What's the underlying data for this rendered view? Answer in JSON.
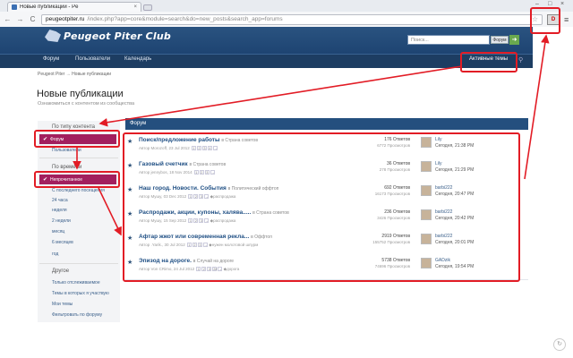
{
  "browser": {
    "tab_title": "Новые публикации - Pe",
    "tab_close": "×",
    "url_host": "peugeotpiter.ru",
    "url_path": "/index.php?app=core&module=search&do=new_posts&search_app=forums",
    "back": "←",
    "forward": "→",
    "reload": "C",
    "star": "☆",
    "ext_label": "D",
    "menu": "≡",
    "win_min": "–",
    "win_max": "□",
    "win_close": "×"
  },
  "site": {
    "logo_text": "Peugeot Piter Club",
    "search_placeholder": "Поиск...",
    "search_scope": "Форум",
    "search_go": "➜",
    "nav": [
      "Форум",
      "Пользователи",
      "Календарь"
    ],
    "active_topics": "Активные темы",
    "pin": "⚲"
  },
  "breadcrumb": "Peugeot Piter  →  Новые публикации",
  "page": {
    "title": "Новые публикации",
    "subtitle": "Ознакомиться с контентом из сообщества"
  },
  "sidebar": {
    "head_content": "По типу контента",
    "active_forum": "Форум",
    "users": "Пользователи",
    "head_time": "По времени",
    "active_unread": "Непрочитанное",
    "time_items": [
      "С последнего посещения",
      "24 часа",
      "неделя",
      "2 недели",
      "месяц",
      "6 месяцев",
      "год"
    ],
    "head_other": "Другое",
    "other_items": [
      "Только отслеживаемое",
      "Темы в которых я участвую",
      "Мои темы",
      "Фильтровать по форуму"
    ],
    "check": "✔"
  },
  "panel_title": "Форум",
  "topics": [
    {
      "title": "Поиск/предложение работы",
      "forum": "в Страна советов",
      "meta": "Автор Morozoff, 23 Jul 2012",
      "pages": [
        "1",
        "2",
        "3",
        "4"
      ],
      "replies": "176 Ответов",
      "views": "6772 Просмотров",
      "user": "Lily",
      "date": "Сегодня, 21:38 PM"
    },
    {
      "title": "Газовый счетчик",
      "forum": "в Страна советов",
      "meta": "Автор jennybos, 18 Nov 2014",
      "pages": [
        "1",
        "2",
        "3"
      ],
      "replies": "36 Ответов",
      "views": "278 Просмотров",
      "user": "Lily",
      "date": "Сегодня, 21:29 PM"
    },
    {
      "title": "Наш город. Новости. События",
      "forum": "в Политический оффтоп",
      "meta": "Автор Myшy, 03 Dec 2012",
      "pages": [
        "1",
        "2",
        "3"
      ],
      "tag": "распродажа",
      "replies": "692 Ответов",
      "views": "16173 Просмотров",
      "user": "barbi222",
      "date": "Сегодня, 20:47 PM"
    },
    {
      "title": "Распродажи, акции, купоны, халява.....",
      "forum": "в Страна советов",
      "meta": "Автор Myшy, 15 Sep 2012",
      "pages": [
        "1",
        "2",
        "3"
      ],
      "tag": "распродажа",
      "replies": "236 Ответов",
      "views": "3426 Просмотров",
      "user": "barbi222",
      "date": "Сегодня, 20:42 PM"
    },
    {
      "title": "Афтар жжот или современная рекла...",
      "forum": "в Оффтоп",
      "meta": "Автор .Yarik., 30 Jul 2012",
      "pages": [
        "1",
        "2",
        "3"
      ],
      "tag": "нужен молотовой шпурм",
      "replies": "2919 Ответов",
      "views": "155752 Просмотров",
      "user": "barbi222",
      "date": "Сегодня, 20:01 PM"
    },
    {
      "title": "Эпизод на дороге.",
      "forum": "в Случай на дороге",
      "meta": "Автор Von CRimo, 24 Jul 2012",
      "pages": [
        "1",
        "2",
        "3",
        "247"
      ],
      "tag": "дорога",
      "replies": "5738 Ответов",
      "views": "74696 Просмотров",
      "user": "GADzik",
      "date": "Сегодня, 19:54 PM"
    }
  ],
  "topic_star": "★",
  "tag_icon": "◆",
  "page_arrow": "→",
  "corner": "↻",
  "colors": {
    "header": "#244f7e",
    "navbar": "#1d3d62",
    "active_sidebar": "#a21f5e",
    "annotation": "#e21c25"
  }
}
